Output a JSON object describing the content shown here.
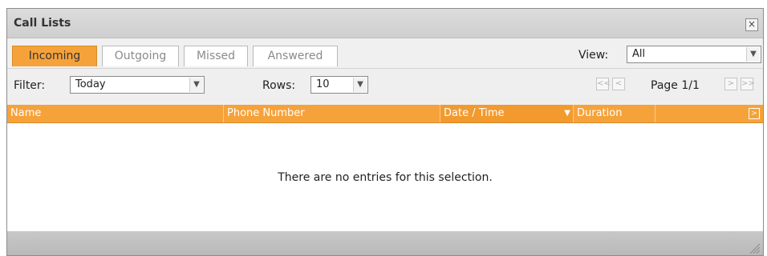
{
  "window": {
    "title": "Call Lists",
    "close_glyph": "×"
  },
  "tabs": [
    {
      "label": "Incoming",
      "active": true
    },
    {
      "label": "Outgoing",
      "active": false
    },
    {
      "label": "Missed",
      "active": false
    },
    {
      "label": "Answered",
      "active": false
    }
  ],
  "view": {
    "label": "View:",
    "selected": "All"
  },
  "filter": {
    "label": "Filter:",
    "selected": "Today"
  },
  "rows": {
    "label": "Rows:",
    "selected": "10"
  },
  "pagination": {
    "first_glyph": "<<",
    "prev_glyph": "<",
    "next_glyph": ">",
    "last_glyph": ">>",
    "page_text": "Page 1/1"
  },
  "columns": {
    "name": "Name",
    "phone": "Phone Number",
    "datetime": "Date / Time",
    "duration": "Duration",
    "sort_glyph": "▼",
    "picker_glyph": ">"
  },
  "table": {
    "empty_message": "There are no entries for this selection."
  },
  "colors": {
    "accent": "#f6a23a",
    "titlebar": "#d6d6d6",
    "footer": "#bdbdbd"
  },
  "icons": {
    "close": "close-icon",
    "dropdown": "chevron-down-icon",
    "sort": "sort-desc-icon",
    "resize": "resize-grip-icon"
  }
}
